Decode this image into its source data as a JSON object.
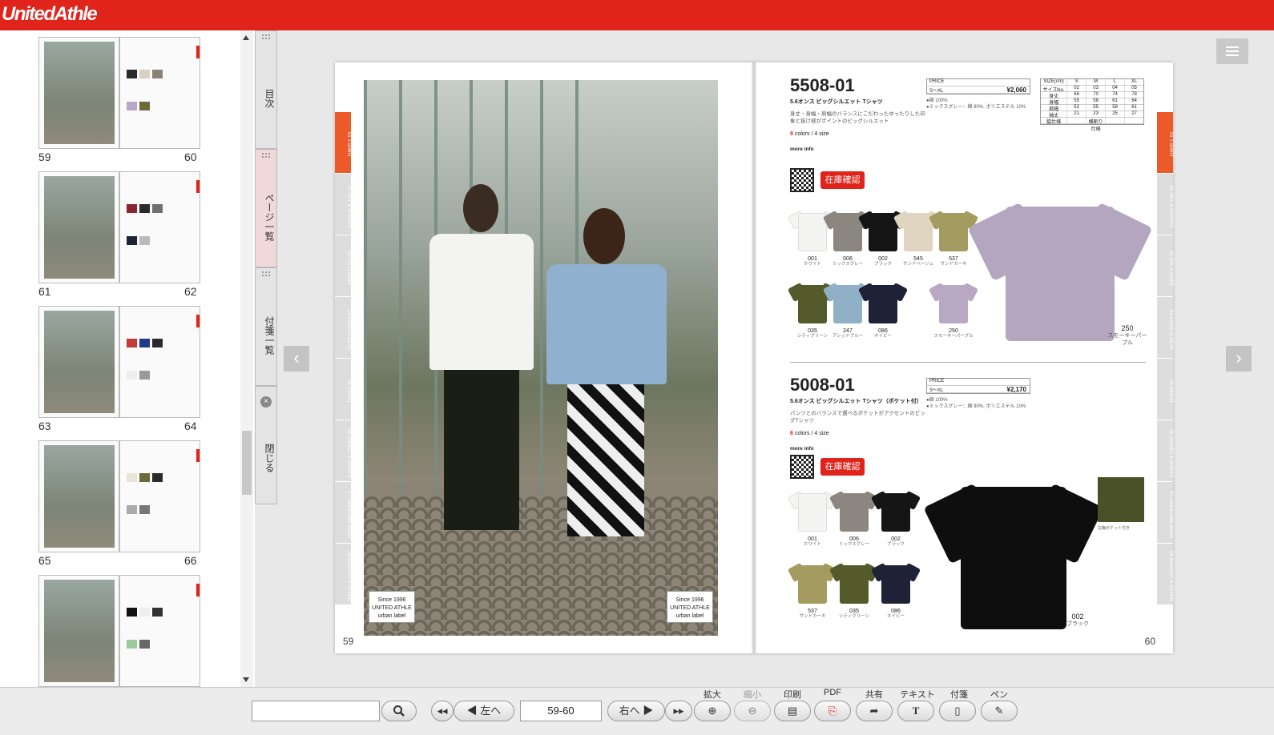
{
  "app": {
    "logo": "UnitedAthle"
  },
  "thumbnails": [
    {
      "left": "59",
      "right": "60"
    },
    {
      "left": "61",
      "right": "62"
    },
    {
      "left": "63",
      "right": "64"
    },
    {
      "left": "65",
      "right": "66"
    },
    {
      "left": "",
      "right": ""
    }
  ],
  "side_tabs": {
    "toc": "目次",
    "page_list": "ページ一覧",
    "sticky_list": "付箋一覧",
    "close": "閉じる"
  },
  "categories_left": [
    "01 T-SHIRT",
    "02 DRY & SPORTS",
    "03 POLO SHIRT",
    "04 LONG SLEEVE",
    "05 SWEAT",
    "06 JACKET & SHIRTS",
    "07 United Athle Works",
    "08 BAG/CAP & OTHER"
  ],
  "left_page": {
    "folio": "59",
    "stamp_lines": [
      "Since 1996",
      "UNITED ATHLE",
      "urban label"
    ]
  },
  "right_page": {
    "folio": "60"
  },
  "product1": {
    "code": "5508-01",
    "subtitle": "5.6オンス ビッグシルエット Tシャツ",
    "desc": "身丈・身幅・肩幅のバランスにこだわったゆったりした印象と抜け感がポイントのビッグシルエット",
    "colors_count": "9",
    "colors_rest": "colors / 4 size",
    "more_info": "more info",
    "stock": "在庫確認",
    "price_head": "PRICE",
    "price_range": "S～XL",
    "price": "¥2,060",
    "spec1": "●綿 100%",
    "spec2": "●ミックスグレー：綿 90%, ポリエステル 10%",
    "size_head": [
      "SIZE(cm)",
      "S",
      "M",
      "L",
      "XL"
    ],
    "size_rows": [
      [
        "サイズNo.",
        "02",
        "03",
        "04",
        "05"
      ],
      [
        "身丈",
        "66",
        "70",
        "74",
        "78"
      ],
      [
        "身幅",
        "55",
        "58",
        "61",
        "64"
      ],
      [
        "肩幅",
        "52",
        "55",
        "58",
        "61"
      ],
      [
        "袖丈",
        "21",
        "23",
        "25",
        "27"
      ],
      [
        "脇仕様",
        "",
        "横割り仕様",
        "",
        ""
      ]
    ],
    "swatches": [
      {
        "no": "001",
        "name": "ホワイト",
        "color": "#f4f4f2"
      },
      {
        "no": "006",
        "name": "ミックスグレー",
        "color": "#8c8680"
      },
      {
        "no": "002",
        "name": "ブラック",
        "color": "#151515"
      },
      {
        "no": "545",
        "name": "サンドベージュ",
        "color": "#e0d5c0"
      },
      {
        "no": "537",
        "name": "サンドカーキ",
        "color": "#a49b60"
      },
      {
        "no": "035",
        "name": "シティグリーン",
        "color": "#545a2a"
      },
      {
        "no": "247",
        "name": "アシッドブルー",
        "color": "#8fb0c6"
      },
      {
        "no": "086",
        "name": "ネイビー",
        "color": "#1f2236"
      },
      {
        "no": "250",
        "name": "スモーキーパープル",
        "color": "#b9a8c4"
      }
    ],
    "big": {
      "no": "250",
      "name": "スモーキーパープル",
      "color": "#b5a6c0"
    }
  },
  "product2": {
    "code": "5008-01",
    "subtitle": "5.6オンス ビッグシルエット Tシャツ（ポケット付）",
    "desc": "パンツとのバランスで選べるポケットがアクセントのビッグTシャツ",
    "colors_count": "6",
    "colors_rest": "colors / 4 size",
    "more_info": "more info",
    "stock": "在庫確認",
    "price_head": "PRICE",
    "price_range": "S～XL",
    "price": "¥2,170",
    "spec1": "●綿 100%",
    "spec2": "●ミックスグレー：綿 90%, ポリエステル 10%",
    "pocket_note": "左胸ポケット付き",
    "swatches": [
      {
        "no": "001",
        "name": "ホワイト",
        "color": "#f4f4f2"
      },
      {
        "no": "006",
        "name": "ミックスグレー",
        "color": "#8c8680"
      },
      {
        "no": "002",
        "name": "ブラック",
        "color": "#151515"
      },
      {
        "no": "537",
        "name": "サンドカーキ",
        "color": "#a49b60"
      },
      {
        "no": "035",
        "name": "シティグリーン",
        "color": "#545a2a"
      },
      {
        "no": "086",
        "name": "ネイビー",
        "color": "#1f2236"
      }
    ],
    "big": {
      "no": "002",
      "name": "ブラック",
      "color": "#0e0e0e"
    }
  },
  "toolbar": {
    "prev_label": "左へ",
    "next_label": "右へ",
    "page_value": "59-60",
    "zoom_in": "拡大",
    "zoom_out": "縮小",
    "print": "印刷",
    "pdf": "PDF",
    "share": "共有",
    "text": "テキスト",
    "sticky": "付箋",
    "pen": "ペン"
  }
}
